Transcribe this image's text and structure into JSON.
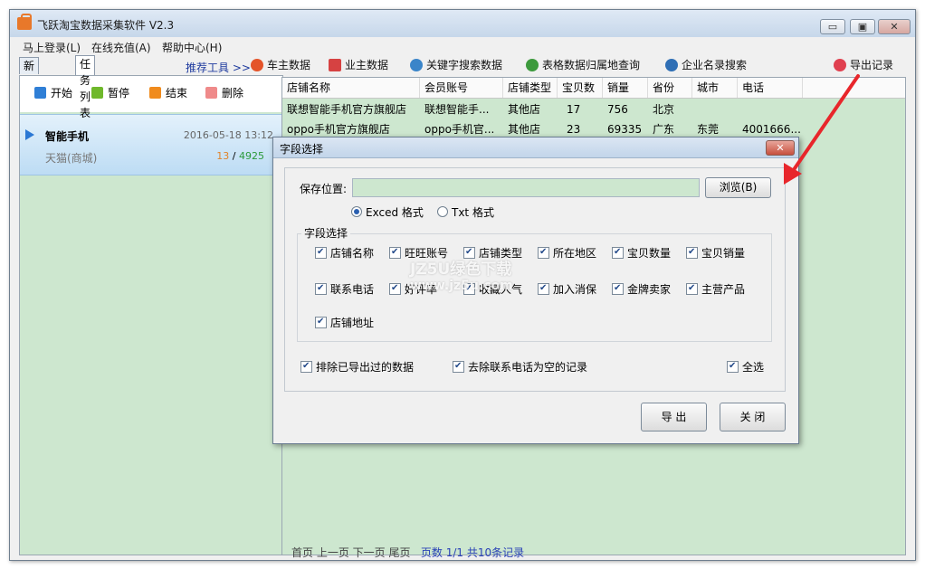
{
  "app": {
    "title": "飞跃淘宝数据采集软件 V2.3"
  },
  "window_controls": {
    "minimize": "▭",
    "maximize": "▣",
    "close": "✕"
  },
  "menu": [
    "马上登录(L)",
    "在线充值(A)",
    "帮助中心(H)"
  ],
  "tabs": [
    "新建任务",
    "任务列表"
  ],
  "toolbar": {
    "label": "推荐工具 >>",
    "items": [
      {
        "label": "车主数据",
        "icon": "car-owner-icon",
        "color": "#e4542a"
      },
      {
        "label": "业主数据",
        "icon": "house-icon",
        "color": "#d64242"
      },
      {
        "label": "关键字搜索数据",
        "icon": "search-globe-icon",
        "color": "#3a85c9"
      },
      {
        "label": "表格数据归属地查询",
        "icon": "table-globe-icon",
        "color": "#3d9a3d"
      },
      {
        "label": "企业名录搜索",
        "icon": "magnifier-icon",
        "color": "#2f6fb5"
      },
      {
        "label": "导出记录",
        "icon": "export-heart-icon",
        "color": "#e0404f"
      }
    ]
  },
  "task_actions": [
    {
      "label": "开始",
      "color": "#2f7fd6",
      "icon": "play-icon"
    },
    {
      "label": "暂停",
      "color": "#6fb82b",
      "icon": "pause-icon"
    },
    {
      "label": "结束",
      "color": "#f08b1d",
      "icon": "stop-icon"
    },
    {
      "label": "删除",
      "color": "#ef8a8a",
      "icon": "trash-icon"
    }
  ],
  "task": {
    "name": "智能手机",
    "date": "2016-05-18 13:12",
    "platform": "天猫(商城)",
    "done": "13",
    "separator": " / ",
    "total": "4925"
  },
  "grid": {
    "headers": [
      "店铺名称",
      "会员账号",
      "店铺类型",
      "宝贝数",
      "销量",
      "省份",
      "城市",
      "电话"
    ],
    "rows": [
      [
        "联想智能手机官方旗舰店",
        "联想智能手...",
        "其他店",
        "17",
        "756",
        "北京",
        "",
        ""
      ],
      [
        "oppo手机官方旗舰店",
        "oppo手机官...",
        "其他店",
        "23",
        "69335",
        "广东",
        "东莞",
        "4001666..."
      ]
    ]
  },
  "pager": {
    "text": "首页  上一页  下一页  尾页",
    "info": "页数 1/1 共10条记录"
  },
  "dialog": {
    "title": "字段选择",
    "close": "✕",
    "save_label": "保存位置:",
    "browse": "浏览(B)",
    "format_exced": "Exced 格式",
    "format_txt": "Txt 格式",
    "fields_legend": "字段选择",
    "fields": [
      "店铺名称",
      "旺旺账号",
      "店铺类型",
      "所在地区",
      "宝贝数量",
      "宝贝销量",
      "联系电话",
      "好评率",
      "收藏人气",
      "加入消保",
      "金牌卖家",
      "主营产品",
      "店铺地址"
    ],
    "exclude_exported": "排除已导出过的数据",
    "remove_empty_phone": "去除联系电话为空的记录",
    "select_all": "全选",
    "export_btn": "导 出",
    "close_btn": "关 闭"
  },
  "watermark": {
    "line1": "JZ5U绿色下载",
    "line2": "www.jz5u.com"
  }
}
